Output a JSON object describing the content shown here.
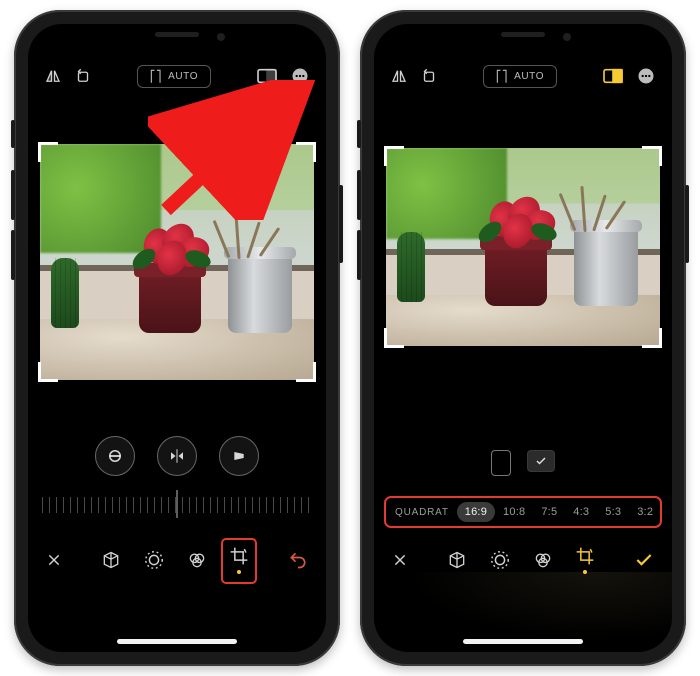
{
  "top": {
    "auto_label": "AUTO"
  },
  "aspect": {
    "options": [
      "QUADRAT",
      "16:9",
      "10:8",
      "7:5",
      "4:3",
      "5:3",
      "3:2"
    ],
    "selected_index": 1
  },
  "icons": {
    "flip_h": "flip-horizontal-icon",
    "rotate": "rotate-icon",
    "aspect": "aspect-ratio-icon",
    "more": "more-icon",
    "straighten": "straighten-icon",
    "mirror_h": "mirror-horizontal-icon",
    "perspective": "perspective-icon",
    "portrait": "orientation-portrait-icon",
    "landscape": "orientation-landscape-icon",
    "close": "close-icon",
    "cube": "cube-icon",
    "adjust": "adjust-icon",
    "filters": "filters-icon",
    "crop": "crop-rotate-icon",
    "undo": "undo-icon",
    "done": "done-icon"
  }
}
